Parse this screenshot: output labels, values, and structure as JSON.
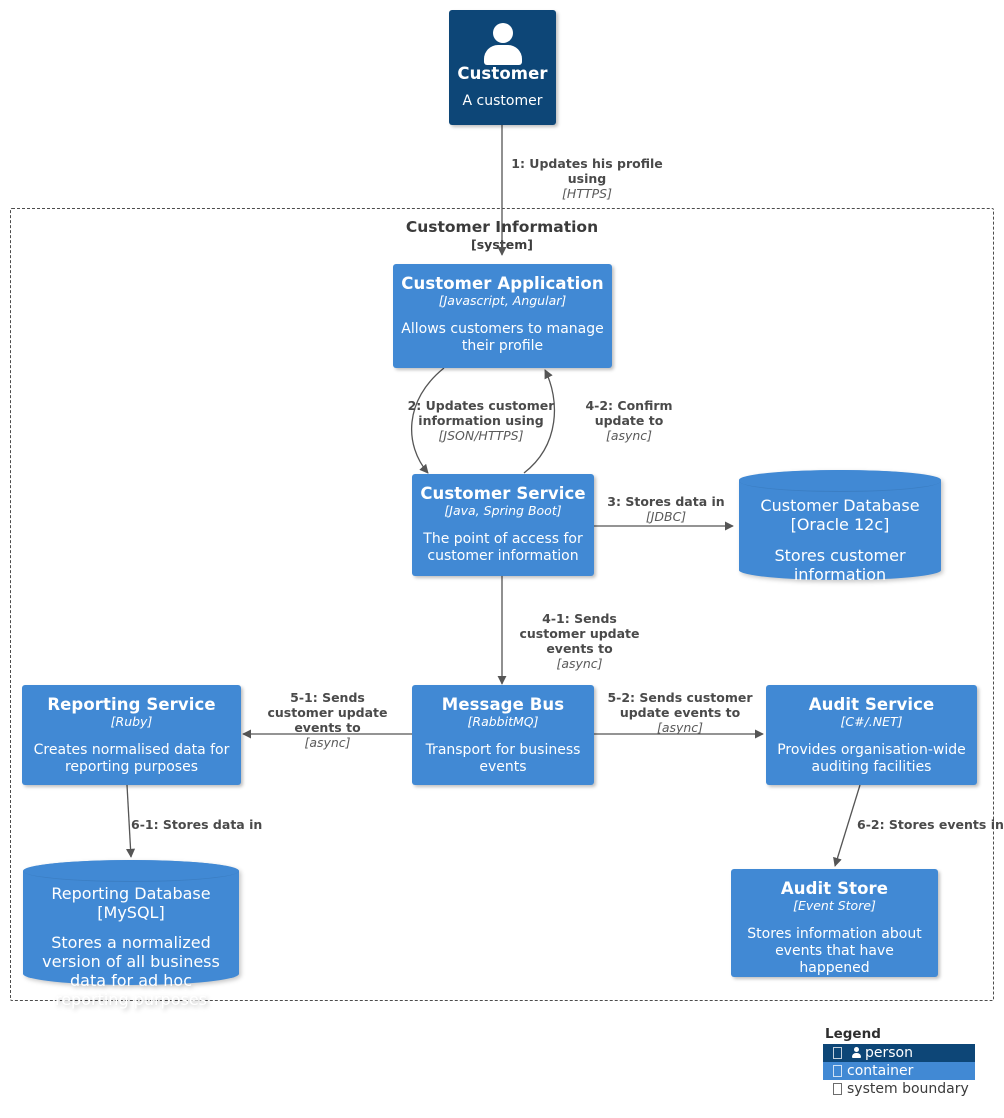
{
  "diagram": {
    "boundary": {
      "name": "Customer Information",
      "type": "[system]"
    },
    "nodes": [
      {
        "id": "customer",
        "kind": "person",
        "title": "Customer",
        "tech": "",
        "description": "A customer",
        "color": "#0d4677"
      },
      {
        "id": "customer-application",
        "kind": "container",
        "title": "Customer Application",
        "tech": "[Javascript, Angular]",
        "description": "Allows customers to manage their profile",
        "color": "#4189d4"
      },
      {
        "id": "customer-service",
        "kind": "container",
        "title": "Customer Service",
        "tech": "[Java, Spring Boot]",
        "description": "The point of access for customer information",
        "color": "#4189d4"
      },
      {
        "id": "customer-database",
        "kind": "database",
        "title": "Customer Database",
        "tech": "[Oracle 12c]",
        "description": "Stores customer information",
        "color": "#4189d4"
      },
      {
        "id": "message-bus",
        "kind": "container",
        "title": "Message Bus",
        "tech": "[RabbitMQ]",
        "description": "Transport for business events",
        "color": "#4189d4"
      },
      {
        "id": "reporting-service",
        "kind": "container",
        "title": "Reporting Service",
        "tech": "[Ruby]",
        "description": "Creates normalised data for reporting purposes",
        "color": "#4189d4"
      },
      {
        "id": "audit-service",
        "kind": "container",
        "title": "Audit Service",
        "tech": "[C#/.NET]",
        "description": "Provides organisation-wide auditing facilities",
        "color": "#4189d4"
      },
      {
        "id": "reporting-database",
        "kind": "database",
        "title": "Reporting Database",
        "tech": "[MySQL]",
        "description": "Stores a normalized version of all business data for ad hoc reporting purposes",
        "color": "#4189d4"
      },
      {
        "id": "audit-store",
        "kind": "container",
        "title": "Audit Store",
        "tech": "[Event Store]",
        "description": "Stores information about events that have happened",
        "color": "#4189d4"
      }
    ],
    "edges": [
      {
        "id": "e1",
        "from": "customer",
        "to": "customer-application",
        "label": "1: Updates his profile using",
        "tech": "[HTTPS]"
      },
      {
        "id": "e2",
        "from": "customer-application",
        "to": "customer-service",
        "label": "2: Updates customer information using",
        "tech": "[JSON/HTTPS]"
      },
      {
        "id": "e3",
        "from": "customer-service",
        "to": "customer-database",
        "label": "3: Stores data in",
        "tech": "[JDBC]"
      },
      {
        "id": "e4-1",
        "from": "customer-service",
        "to": "message-bus",
        "label": "4-1: Sends customer update events to",
        "tech": "[async]"
      },
      {
        "id": "e4-2",
        "from": "customer-service",
        "to": "customer-application",
        "label": "4-2: Confirm update to",
        "tech": "[async]"
      },
      {
        "id": "e5-1",
        "from": "message-bus",
        "to": "reporting-service",
        "label": "5-1: Sends customer update events to",
        "tech": "[async]"
      },
      {
        "id": "e5-2",
        "from": "message-bus",
        "to": "audit-service",
        "label": "5-2: Sends customer update events to",
        "tech": "[async]"
      },
      {
        "id": "e6-1",
        "from": "reporting-service",
        "to": "reporting-database",
        "label": "6-1: Stores data in",
        "tech": ""
      },
      {
        "id": "e6-2",
        "from": "audit-service",
        "to": "audit-store",
        "label": "6-2: Stores events in",
        "tech": ""
      }
    ],
    "legend": {
      "title": "Legend",
      "items": [
        {
          "label": "person",
          "icon": "person-icon",
          "color": "#0d4677"
        },
        {
          "label": "container",
          "icon": "container-icon",
          "color": "#4189d4"
        },
        {
          "label": "system boundary",
          "icon": "boundary-icon",
          "color": "#ffffff"
        }
      ]
    }
  }
}
